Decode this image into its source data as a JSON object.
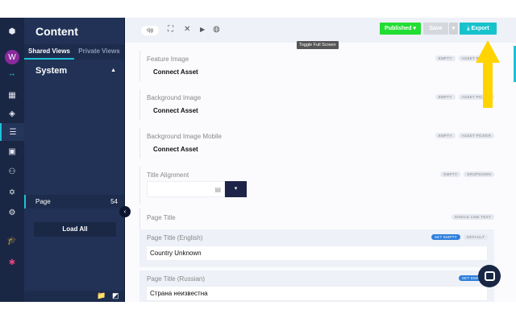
{
  "sidebar": {
    "title": "Content",
    "avatar": "W",
    "tabs": [
      "Shared Views",
      "Private Views"
    ],
    "group": "System",
    "item": {
      "label": "Page",
      "count": "54"
    },
    "load_all": "Load All"
  },
  "toolbar": {
    "locale": "cjg",
    "tooltip": "Toggle Full Screen",
    "published": "Published ▾",
    "save": "Save",
    "export": "Export"
  },
  "fields": [
    {
      "label": "Feature Image",
      "value": "Connect Asset",
      "badges": [
        "EMPTY",
        "ASSET PICKER"
      ]
    },
    {
      "label": "Background Image",
      "value": "Connect Asset",
      "badges": [
        "EMPTY",
        "ASSET PICKER"
      ]
    },
    {
      "label": "Background Image Mobile",
      "value": "Connect Asset",
      "badges": [
        "EMPTY",
        "ASSET PICKER"
      ]
    },
    {
      "label": "Title Alignment",
      "badges": [
        "EMPTY",
        "DROPDOWN"
      ]
    },
    {
      "label": "Page Title",
      "badges": [
        "SINGLE LINE TEXT"
      ]
    },
    {
      "label": "Page Title (English)",
      "value": "Country Unknown",
      "badges": [
        "SET EMPTY",
        "DEFAULT"
      ]
    },
    {
      "label": "Page Title (Russian)",
      "value": "Страна неизвестна",
      "badges": [
        "SET EMPTY"
      ]
    }
  ],
  "colors": {
    "rail": "#1a2744",
    "sidebar": "#213256",
    "accent": "#1fc0d6",
    "published": "#22dd33",
    "export": "#18c2cc",
    "arrow": "#ffd400"
  }
}
